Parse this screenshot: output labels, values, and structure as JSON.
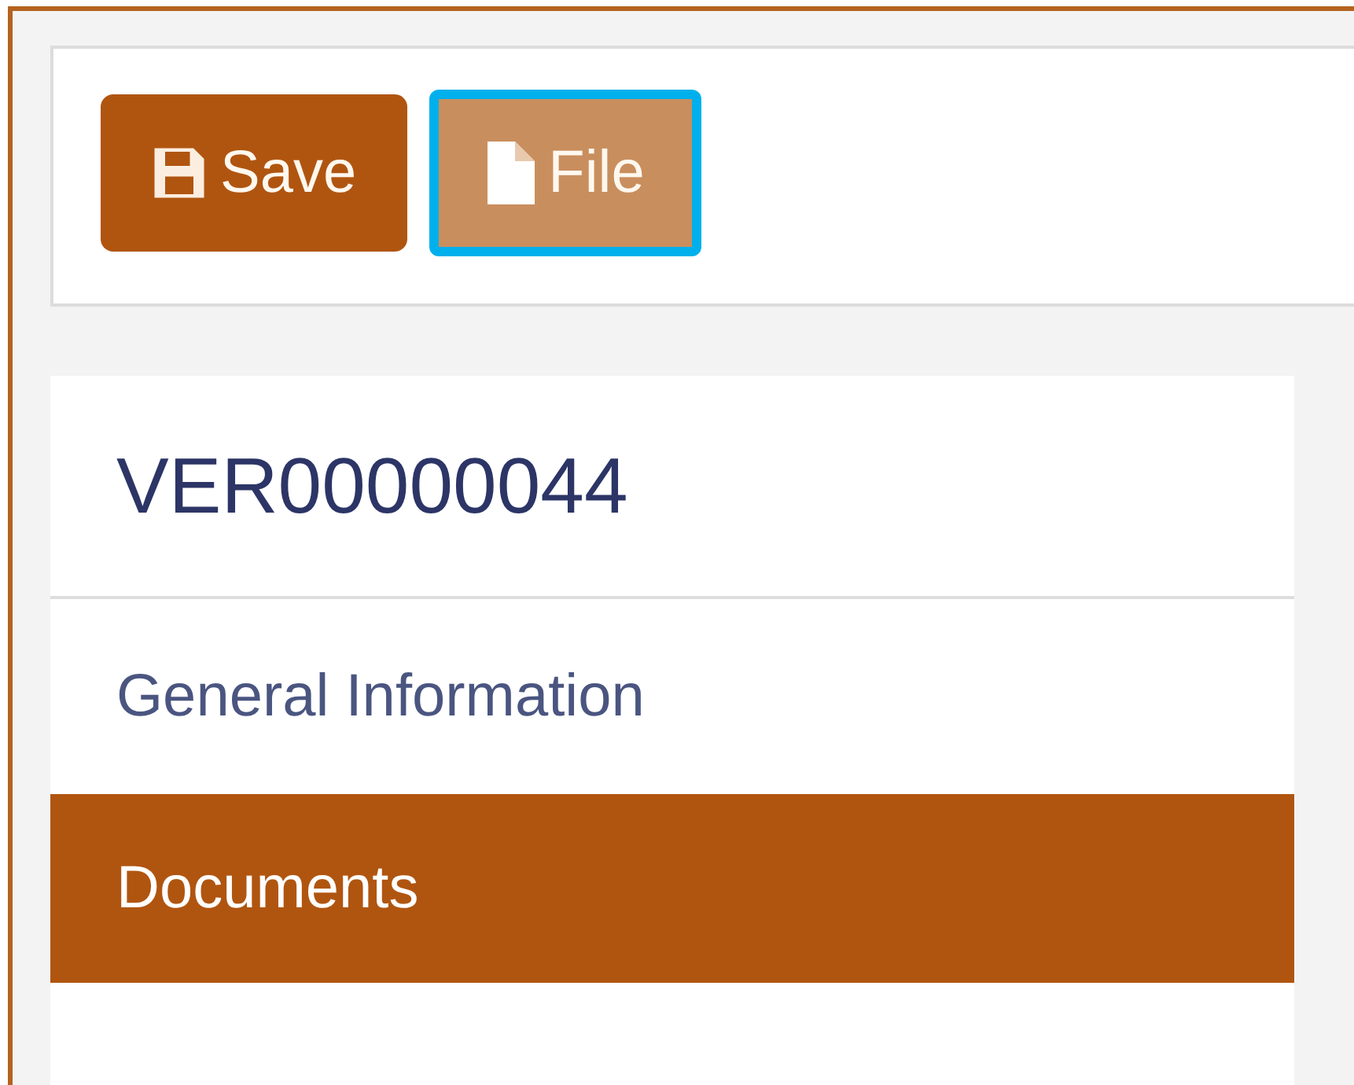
{
  "toolbar": {
    "buttons": [
      {
        "kind": "save",
        "label": "Save",
        "highlighted": false
      },
      {
        "kind": "file",
        "label": "File",
        "highlighted": true
      }
    ]
  },
  "record": {
    "title": "VER00000044",
    "nav_items": [
      {
        "label": "General Information",
        "selected": false
      },
      {
        "label": "Documents",
        "selected": true
      }
    ]
  }
}
